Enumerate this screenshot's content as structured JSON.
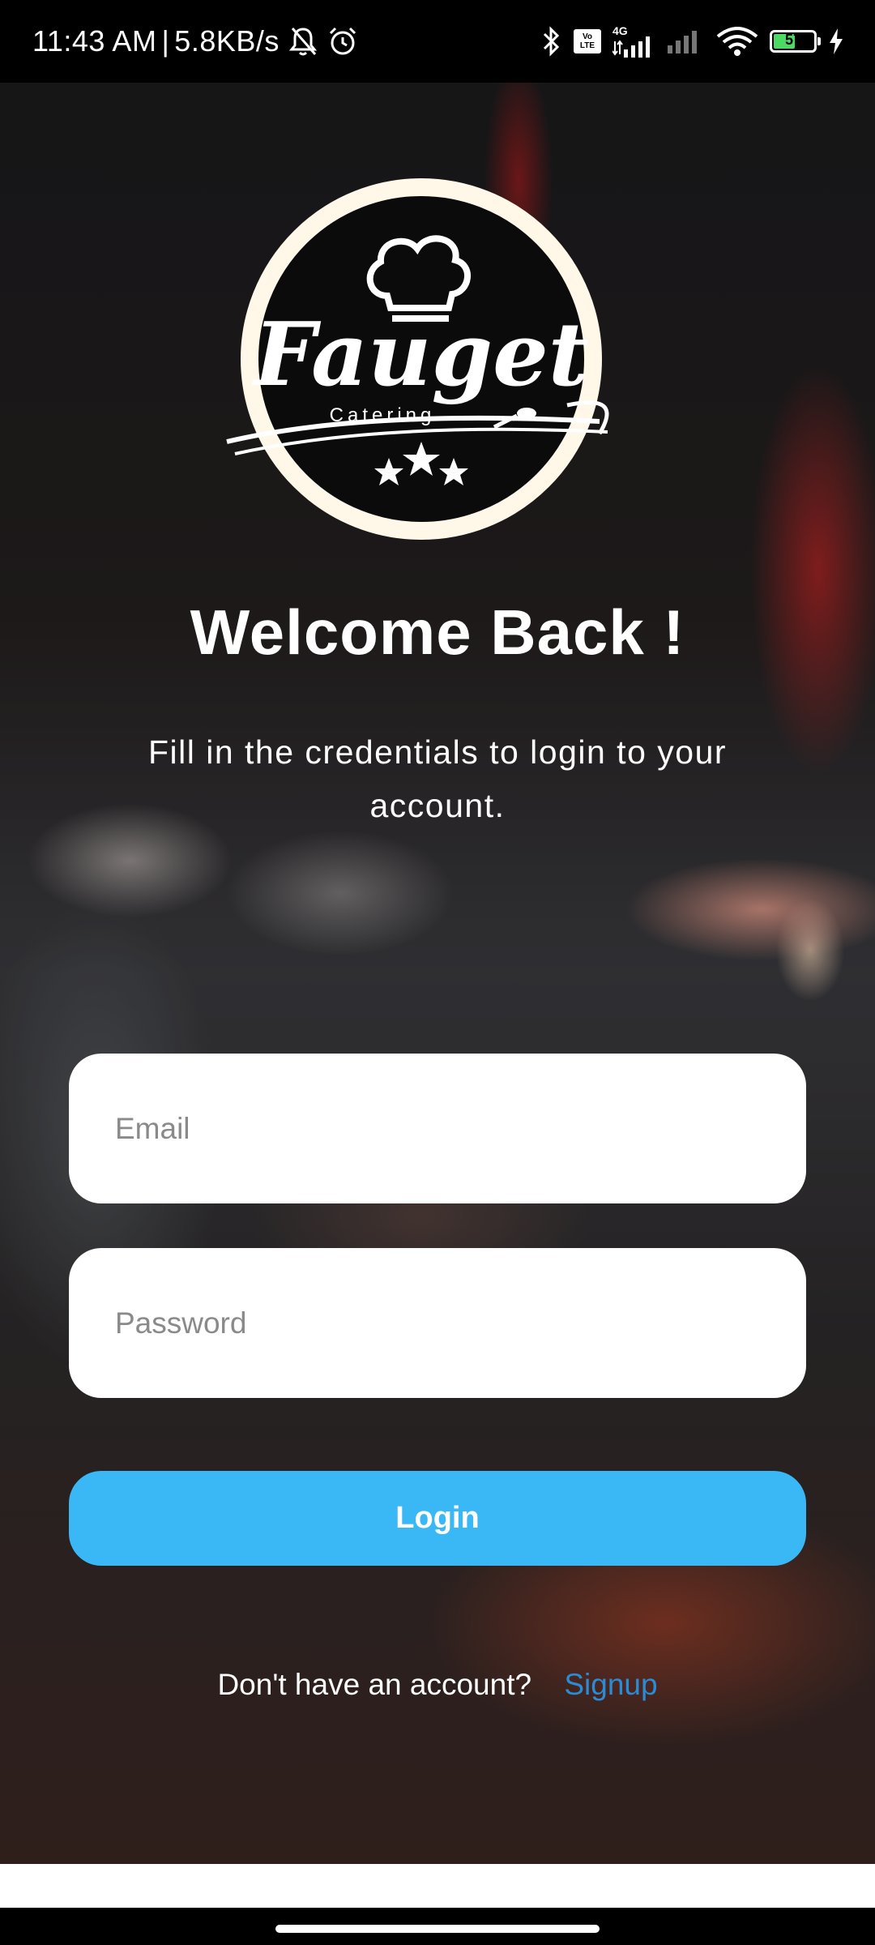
{
  "status_bar": {
    "time": "11:43 AM",
    "separator": "|",
    "net_speed": "5.8KB/s",
    "volte_top": "Vo",
    "volte_bottom": "LTE",
    "network_type": "4G",
    "battery_level": "57",
    "battery_fill_fraction": 0.57,
    "icons": [
      "bell-off-icon",
      "alarm-icon",
      "bluetooth-icon",
      "volte-icon",
      "signal-icon",
      "wifi-icon",
      "battery-icon",
      "charging-icon"
    ]
  },
  "logo": {
    "brand": "Fauget",
    "tagline": "Catering"
  },
  "welcome": {
    "title": "Welcome Back !",
    "subtitle": "Fill in the credentials to login to your account."
  },
  "form": {
    "email_placeholder": "Email",
    "password_placeholder": "Password",
    "login_label": "Login"
  },
  "signup": {
    "prompt": "Don't have an account?",
    "link_label": "Signup"
  },
  "colors": {
    "accent": "#3ab8f5",
    "link": "#2b8cd6",
    "battery": "#4cd964"
  }
}
